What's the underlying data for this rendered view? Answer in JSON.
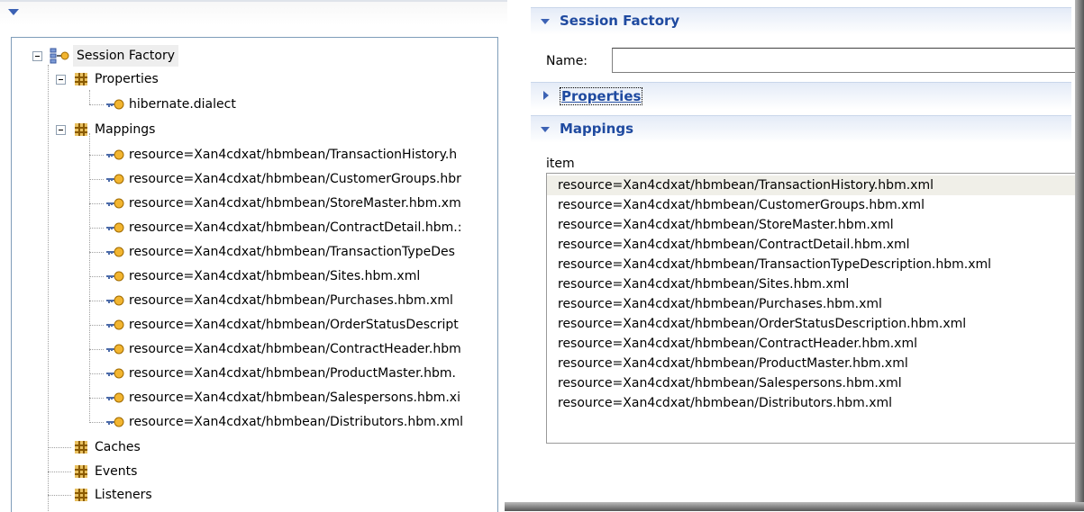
{
  "tree": {
    "root": "Session Factory",
    "properties": {
      "label": "Properties",
      "children": [
        "hibernate.dialect"
      ]
    },
    "mappings": {
      "label": "Mappings",
      "children": [
        "resource=Xan4cdxat/hbmbean/TransactionHistory.h",
        "resource=Xan4cdxat/hbmbean/CustomerGroups.hbr",
        "resource=Xan4cdxat/hbmbean/StoreMaster.hbm.xm",
        "resource=Xan4cdxat/hbmbean/ContractDetail.hbm.:",
        "resource=Xan4cdxat/hbmbean/TransactionTypeDes",
        "resource=Xan4cdxat/hbmbean/Sites.hbm.xml",
        "resource=Xan4cdxat/hbmbean/Purchases.hbm.xml",
        "resource=Xan4cdxat/hbmbean/OrderStatusDescript",
        "resource=Xan4cdxat/hbmbean/ContractHeader.hbm",
        "resource=Xan4cdxat/hbmbean/ProductMaster.hbm.",
        "resource=Xan4cdxat/hbmbean/Salespersons.hbm.xi",
        "resource=Xan4cdxat/hbmbean/Distributors.hbm.xml"
      ]
    },
    "caches": "Caches",
    "events": "Events",
    "listeners": "Listeners"
  },
  "details": {
    "session_factory_title": "Session Factory",
    "name_label": "Name:",
    "name_value": "",
    "properties_title": "Properties",
    "mappings_title": "Mappings",
    "item_label": "item",
    "items": [
      "resource=Xan4cdxat/hbmbean/TransactionHistory.hbm.xml",
      "resource=Xan4cdxat/hbmbean/CustomerGroups.hbm.xml",
      "resource=Xan4cdxat/hbmbean/StoreMaster.hbm.xml",
      "resource=Xan4cdxat/hbmbean/ContractDetail.hbm.xml",
      "resource=Xan4cdxat/hbmbean/TransactionTypeDescription.hbm.xml",
      "resource=Xan4cdxat/hbmbean/Sites.hbm.xml",
      "resource=Xan4cdxat/hbmbean/Purchases.hbm.xml",
      "resource=Xan4cdxat/hbmbean/OrderStatusDescription.hbm.xml",
      "resource=Xan4cdxat/hbmbean/ContractHeader.hbm.xml",
      "resource=Xan4cdxat/hbmbean/ProductMaster.hbm.xml",
      "resource=Xan4cdxat/hbmbean/Salespersons.hbm.xml",
      "resource=Xan4cdxat/hbmbean/Distributors.hbm.xml"
    ],
    "selected_index": 0
  },
  "colors": {
    "section_title": "#1f4aa0",
    "arrow": "#3c62b4",
    "selection": "#f0efe8"
  }
}
